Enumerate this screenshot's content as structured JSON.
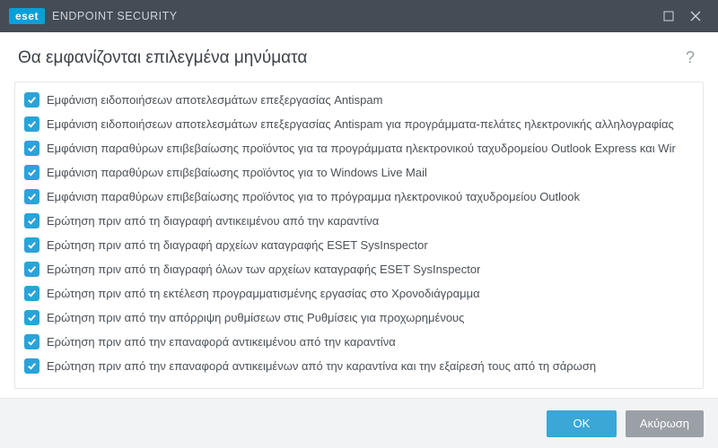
{
  "titlebar": {
    "brand_badge": "eset",
    "brand_text": "ENDPOINT SECURITY"
  },
  "header": {
    "title": "Θα εμφανίζονται επιλεγμένα μηνύματα",
    "help_symbol": "?"
  },
  "list": {
    "items": [
      {
        "checked": true,
        "label": "Εμφάνιση ειδοποιήσεων αποτελεσμάτων επεξεργασίας Antispam"
      },
      {
        "checked": true,
        "label": "Εμφάνιση ειδοποιήσεων αποτελεσμάτων επεξεργασίας Antispam για προγράμματα-πελάτες ηλεκτρονικής αλληλογραφίας"
      },
      {
        "checked": true,
        "label": "Εμφάνιση παραθύρων επιβεβαίωσης προϊόντος για τα προγράμματα ηλεκτρονικού ταχυδρομείου Outlook Express και Wir"
      },
      {
        "checked": true,
        "label": "Εμφάνιση παραθύρων επιβεβαίωσης προϊόντος για το Windows Live Mail"
      },
      {
        "checked": true,
        "label": "Εμφάνιση παραθύρων επιβεβαίωσης προϊόντος για το πρόγραμμα ηλεκτρονικού ταχυδρομείου Outlook"
      },
      {
        "checked": true,
        "label": "Ερώτηση πριν από τη διαγραφή αντικειμένου από την καραντίνα"
      },
      {
        "checked": true,
        "label": "Ερώτηση πριν από τη διαγραφή αρχείων καταγραφής ESET SysInspector"
      },
      {
        "checked": true,
        "label": "Ερώτηση πριν από τη διαγραφή όλων των αρχείων καταγραφής ESET SysInspector"
      },
      {
        "checked": true,
        "label": "Ερώτηση πριν από τη εκτέλεση προγραμματισμένης εργασίας στο Χρονοδιάγραμμα"
      },
      {
        "checked": true,
        "label": "Ερώτηση πριν από την απόρριψη ρυθμίσεων στις Ρυθμίσεις για προχωρημένους"
      },
      {
        "checked": true,
        "label": "Ερώτηση πριν από την επαναφορά αντικειμένου από την καραντίνα"
      },
      {
        "checked": true,
        "label": "Ερώτηση πριν από την επαναφορά αντικειμένων από την καραντίνα και την εξαίρεσή τους από τη σάρωση"
      }
    ]
  },
  "footer": {
    "ok_label": "OK",
    "cancel_label": "Ακύρωση"
  }
}
